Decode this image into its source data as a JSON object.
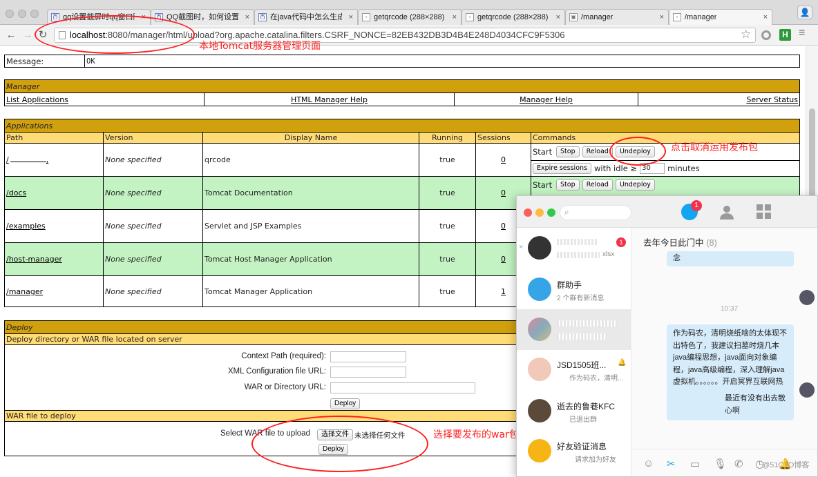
{
  "browser": {
    "tabs": [
      {
        "label": "qq设置截屏时qq窗口隐藏",
        "icon": "baidu-paw-icon"
      },
      {
        "label": "QQ截图时，如何设置隐藏",
        "icon": "baidu-paw-icon"
      },
      {
        "label": "在java代码中怎么生成二维",
        "icon": "baidu-paw-icon"
      },
      {
        "label": "getqrcode (288×288)",
        "icon": "document-icon"
      },
      {
        "label": "getqrcode (288×288)",
        "icon": "document-icon"
      },
      {
        "label": "/manager",
        "icon": "image-icon"
      },
      {
        "label": "/manager",
        "icon": "document-icon"
      }
    ],
    "url_host": "localhost",
    "url_rest": ":8080/manager/html/upload?org.apache.catalina.filters.CSRF_NONCE=82EB432DB3D4B4E248D4034CFC9F5306"
  },
  "message": {
    "label": "Message:",
    "value": "OK"
  },
  "manager": {
    "title": "Manager",
    "links": [
      "List Applications",
      "HTML Manager Help",
      "Manager Help",
      "Server Status"
    ]
  },
  "applications": {
    "title": "Applications",
    "headers": [
      "Path",
      "Version",
      "Display Name",
      "Running",
      "Sessions",
      "Commands"
    ],
    "rows": [
      {
        "path": "/",
        "version": "None specified",
        "display": "qrcode",
        "running": "true",
        "sessions": "0"
      },
      {
        "path": "/docs",
        "version": "None specified",
        "display": "Tomcat Documentation",
        "running": "true",
        "sessions": "0"
      },
      {
        "path": "/examples",
        "version": "None specified",
        "display": "Servlet and JSP Examples",
        "running": "true",
        "sessions": "0"
      },
      {
        "path": "/host-manager",
        "version": "None specified",
        "display": "Tomcat Host Manager Application",
        "running": "true",
        "sessions": "0"
      },
      {
        "path": "/manager",
        "version": "None specified",
        "display": "Tomcat Manager Application",
        "running": "true",
        "sessions": "1"
      }
    ],
    "commands": {
      "start": "Start",
      "stop": "Stop",
      "reload": "Reload",
      "undeploy": "Undeploy",
      "expire": "Expire sessions",
      "with_idle": "with idle ≥",
      "idle_value": "30",
      "minutes": "minutes"
    }
  },
  "deploy": {
    "title": "Deploy",
    "server_header": "Deploy directory or WAR file located on server",
    "context_path": "Context Path (required):",
    "xml_url": "XML Configuration file URL:",
    "war_dir_url": "WAR or Directory URL:",
    "deploy_btn": "Deploy",
    "war_header": "WAR file to deploy",
    "select_label": "Select WAR file to upload",
    "choose_file": "选择文件",
    "no_file": "未选择任何文件",
    "deploy_btn2": "Deploy"
  },
  "annotations": {
    "url_note": "本地Tomcat服务器管理页面",
    "undeploy_note": "点击取消运用发布包",
    "deploy_note": "选择要发布的war包，点击deploy，发布，然后就可以本地访问项目了"
  },
  "chat": {
    "badge": "1",
    "list": [
      {
        "name": "",
        "sub": "xlsx",
        "badge": "1"
      },
      {
        "name": "群助手",
        "sub": "2 个群有新消息"
      },
      {
        "name": "",
        "sub": ""
      },
      {
        "name": "JSD1505班...",
        "sub": "作为码农，清明..."
      },
      {
        "name": "逝去的鲁巷KFC",
        "sub": "已退出群"
      },
      {
        "name": "好友验证消息",
        "sub": "请求加为好友"
      }
    ],
    "conversation": {
      "title": "去年今日此门中",
      "count": "(8)",
      "top_bubble": "念",
      "time": "10:37",
      "message1": "作为码农，清明烧纸啥的太体现不出特色了，我建议扫墓时烧几本java编程思想，java面向对象编程，java高级编程，深入理解java虚拟机。。。。。。开启冥界互联网热",
      "message2": "最近有没有出去散心啊"
    },
    "watermark": "@51CTO博客"
  },
  "colors": {
    "title_bg": "#d1a00d",
    "header_bg": "#ffdc75",
    "even_row": "#c3f3c3",
    "annotation_red": "#ff1f1f"
  }
}
